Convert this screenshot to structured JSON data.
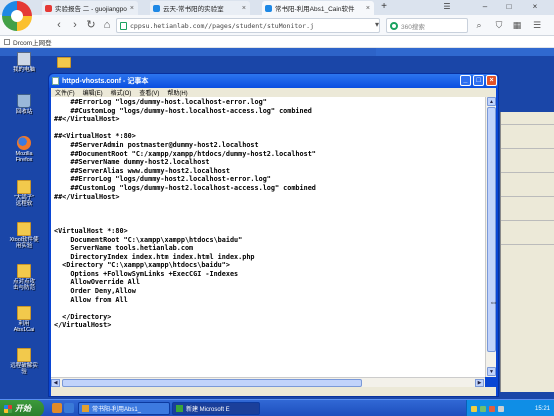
{
  "browser": {
    "tabs": [
      {
        "label": "实验报告 二 - guojiangpo",
        "active": false
      },
      {
        "label": "云天-常书阳的实验室",
        "active": false
      },
      {
        "label": "常书阳-利用Abs1_Cain软件",
        "active": true
      }
    ],
    "new_tab_label": "+",
    "url": "cppsu.hetianlab.com//pages/student/stuMonitor.j",
    "search_placeholder": "360搜索",
    "bookmark": "Drcom上网登",
    "colors": {
      "tab_bar": "#dbe3ee",
      "nav_bar": "#f6f8fb",
      "accent_green": "#1aa260"
    }
  },
  "desktop": {
    "background": "#1a46a8",
    "icons": [
      {
        "name": "my-computer",
        "label": "我的电脑"
      },
      {
        "name": "recycle-bin",
        "label": "回收站"
      },
      {
        "name": "firefox",
        "label": "Mozilla\nFirefox"
      },
      {
        "name": "folder-1",
        "label": "\"大鸽子\"\n远程软"
      },
      {
        "name": "folder-2",
        "label": "Xtool软件使\n用实验"
      },
      {
        "name": "folder-3",
        "label": "点对点攻\n击与防范"
      },
      {
        "name": "folder-4",
        "label": "利用\nAbs1Cai"
      },
      {
        "name": "folder-5",
        "label": "远程破解实\n验"
      }
    ]
  },
  "notepad": {
    "title": "httpd-vhosts.conf - 记事本",
    "menu": [
      "文件(F)",
      "编辑(E)",
      "格式(O)",
      "查看(V)",
      "帮助(H)"
    ],
    "lines": [
      "    ##ErrorLog \"logs/dummy-host.localhost-error.log\"",
      "    ##CustomLog \"logs/dummy-host.localhost-access.log\" combined",
      "##</VirtualHost>",
      "",
      "##<VirtualHost *:80>",
      "    ##ServerAdmin postmaster@dummy-host2.localhost",
      "    ##DocumentRoot \"C:/xampp/xampp/htdocs/dummy-host2.localhost\"",
      "    ##ServerName dummy-host2.localhost",
      "    ##ServerAlias www.dummy-host2.localhost",
      "    ##ErrorLog \"logs/dummy-host2.localhost-error.log\"",
      "    ##CustomLog \"logs/dummy-host2.localhost-access.log\" combined",
      "##</VirtualHost>",
      "",
      "",
      "",
      "<VirtualHost *:80>",
      "    DocumentRoot \"C:\\xampp\\xampp\\htdocs\\baidu\"",
      "    ServerName tools.hetianlab.com",
      "    DirectoryIndex index.htm index.html index.php",
      "  <Directory \"C:\\xampp\\xampp\\htdocs\\baidu\">",
      "    Options +FollowSymLinks +ExecCGI -Indexes",
      "    AllowOverride All",
      "    Order Deny,Allow",
      "    Allow from All",
      "",
      "  </Directory>",
      "</VirtualHost>"
    ]
  },
  "taskbar": {
    "start_label": "开始",
    "items": [
      {
        "label": "常书阳-利用Abs1_",
        "active": false
      },
      {
        "label": "新建 Microsoft E",
        "active": true
      }
    ],
    "clock": "15:21"
  }
}
